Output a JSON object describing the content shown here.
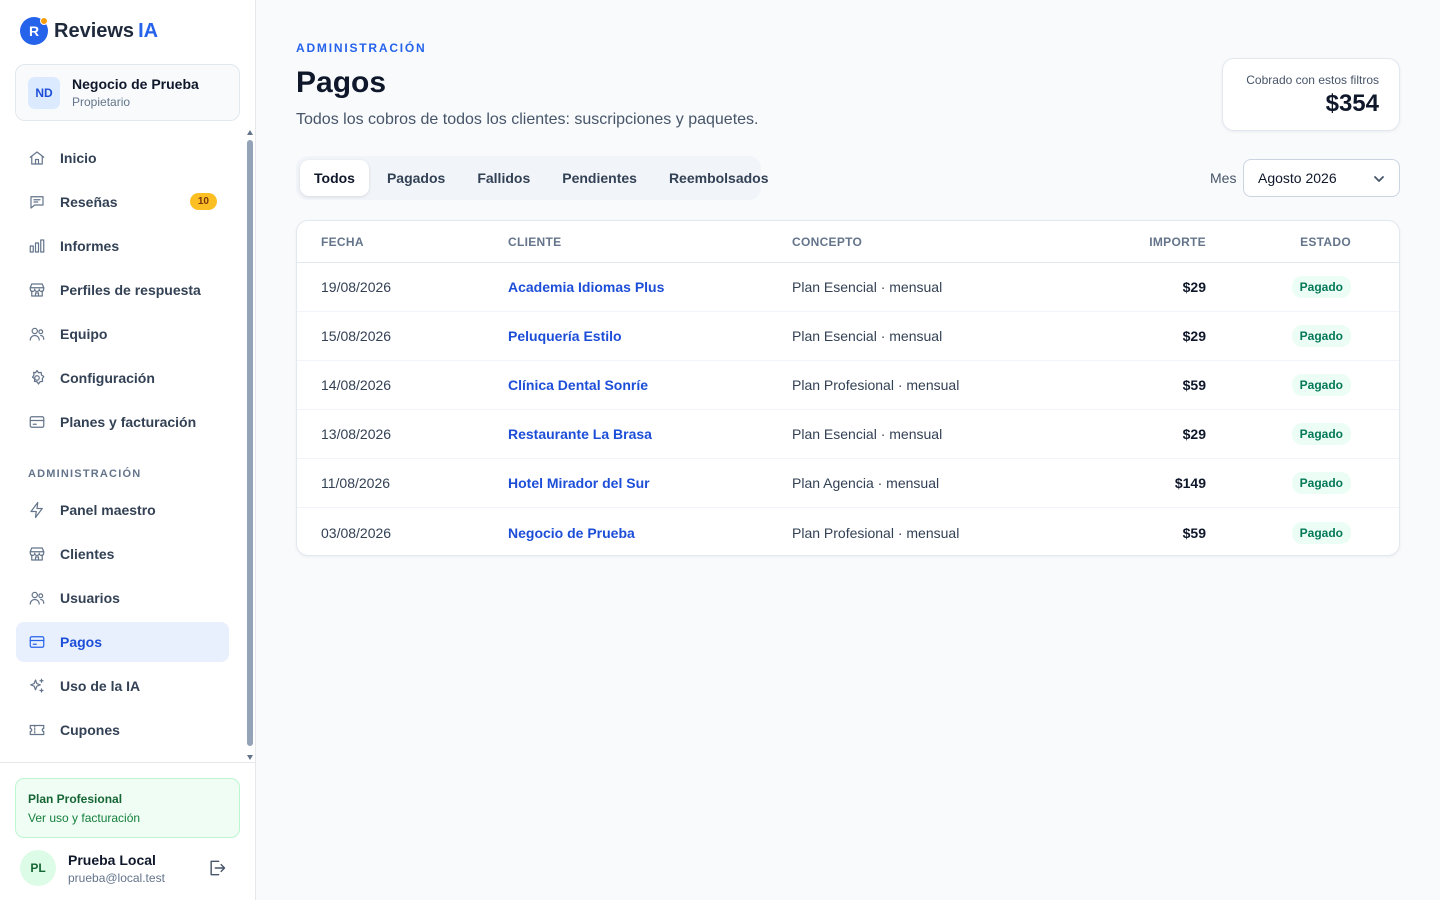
{
  "brand": {
    "logo_letter": "R",
    "name": "Reviews",
    "suffix": "IA"
  },
  "business": {
    "initials": "ND",
    "name": "Negocio de Prueba",
    "role": "Propietario"
  },
  "nav": {
    "items": [
      {
        "label": "Inicio",
        "icon": "home-icon"
      },
      {
        "label": "Reseñas",
        "icon": "message-icon",
        "badge": "10"
      },
      {
        "label": "Informes",
        "icon": "bar-chart-icon"
      },
      {
        "label": "Perfiles de respuesta",
        "icon": "store-icon"
      },
      {
        "label": "Equipo",
        "icon": "users-icon"
      },
      {
        "label": "Configuración",
        "icon": "gear-icon"
      },
      {
        "label": "Planes y facturación",
        "icon": "credit-card-icon"
      }
    ],
    "admin_section_label": "ADMINISTRACIÓN",
    "admin_items": [
      {
        "label": "Panel maestro",
        "icon": "lightning-icon"
      },
      {
        "label": "Clientes",
        "icon": "store-icon"
      },
      {
        "label": "Usuarios",
        "icon": "users-icon"
      },
      {
        "label": "Pagos",
        "icon": "credit-card-icon",
        "active": true
      },
      {
        "label": "Uso de la IA",
        "icon": "sparkles-icon"
      },
      {
        "label": "Cupones",
        "icon": "ticket-icon"
      }
    ]
  },
  "plan": {
    "name": "Plan Profesional",
    "link": "Ver uso y facturación"
  },
  "user": {
    "initials": "PL",
    "name": "Prueba Local",
    "email": "prueba@local.test"
  },
  "header": {
    "eyebrow": "ADMINISTRACIÓN",
    "title": "Pagos",
    "subtitle": "Todos los cobros de todos los clientes: suscripciones y paquetes."
  },
  "total": {
    "label": "Cobrado con estos filtros",
    "value": "$354"
  },
  "tabs": [
    "Todos",
    "Pagados",
    "Fallidos",
    "Pendientes",
    "Reembolsados"
  ],
  "active_tab": "Todos",
  "month_filter": {
    "label": "Mes",
    "value": "Agosto 2026"
  },
  "table": {
    "columns": [
      "FECHA",
      "CLIENTE",
      "CONCEPTO",
      "IMPORTE",
      "ESTADO"
    ],
    "rows": [
      {
        "date": "19/08/2026",
        "client": "Academia Idiomas Plus",
        "concept": "Plan Esencial · mensual",
        "amount": "$29",
        "status": "Pagado"
      },
      {
        "date": "15/08/2026",
        "client": "Peluquería Estilo",
        "concept": "Plan Esencial · mensual",
        "amount": "$29",
        "status": "Pagado"
      },
      {
        "date": "14/08/2026",
        "client": "Clínica Dental Sonríe",
        "concept": "Plan Profesional · mensual",
        "amount": "$59",
        "status": "Pagado"
      },
      {
        "date": "13/08/2026",
        "client": "Restaurante La Brasa",
        "concept": "Plan Esencial · mensual",
        "amount": "$29",
        "status": "Pagado"
      },
      {
        "date": "11/08/2026",
        "client": "Hotel Mirador del Sur",
        "concept": "Plan Agencia · mensual",
        "amount": "$149",
        "status": "Pagado"
      },
      {
        "date": "03/08/2026",
        "client": "Negocio de Prueba",
        "concept": "Plan Profesional · mensual",
        "amount": "$59",
        "status": "Pagado"
      }
    ]
  },
  "colors": {
    "accent": "#2563eb",
    "badge": "#fbbf24",
    "success": "#047857",
    "plan_bg": "#f0fdf4"
  }
}
